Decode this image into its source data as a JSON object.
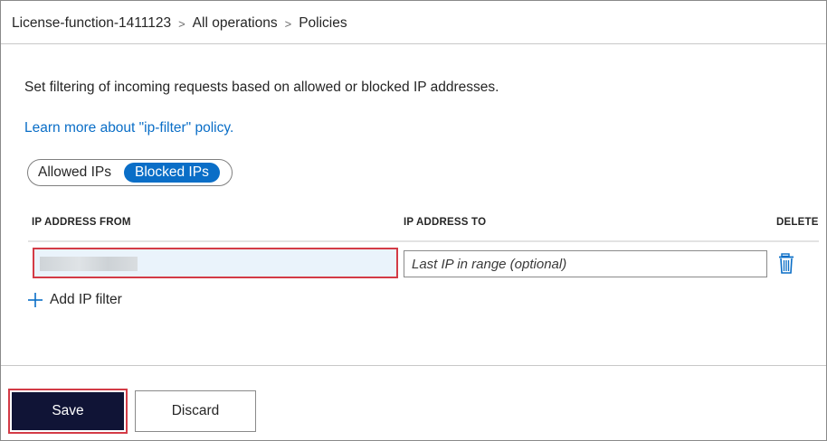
{
  "breadcrumb": {
    "items": [
      "License-function-1411123",
      "All operations",
      "Policies"
    ],
    "separator": ">"
  },
  "description": "Set filtering of incoming requests based on allowed or blocked IP addresses.",
  "learn_more_link": "Learn more about \"ip-filter\" policy.",
  "toggle": {
    "options": [
      "Allowed IPs",
      "Blocked IPs"
    ],
    "selected": "Blocked IPs"
  },
  "table": {
    "columns": [
      "IP ADDRESS FROM",
      "IP ADDRESS TO",
      "DELETE"
    ],
    "rows": [
      {
        "ip_from": "",
        "ip_to": "",
        "ip_to_placeholder": "Last IP in range (optional)"
      }
    ]
  },
  "add_filter_label": "Add IP filter",
  "footer": {
    "save_label": "Save",
    "discard_label": "Discard"
  },
  "colors": {
    "accent": "#0a6ec7",
    "save_bg": "#101436",
    "highlight": "#d33b46"
  },
  "icons": {
    "delete": "trash-icon",
    "add": "plus-icon"
  }
}
